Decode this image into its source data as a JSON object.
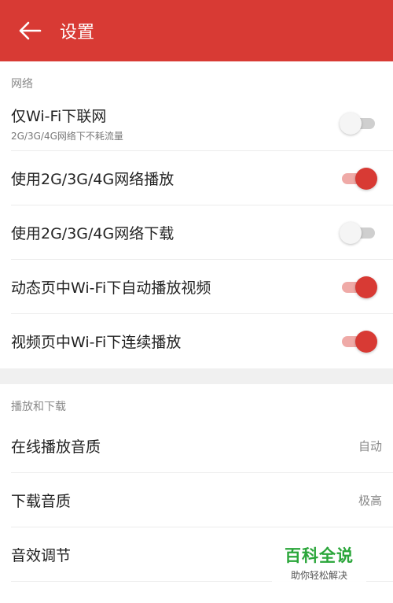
{
  "appbar": {
    "title": "设置",
    "color": "#d83a34"
  },
  "network": {
    "header": "网络",
    "items": [
      {
        "label": "仅Wi-Fi下联网",
        "sub": "2G/3G/4G网络下不耗流量",
        "on": false
      },
      {
        "label": "使用2G/3G/4G网络播放",
        "on": true
      },
      {
        "label": "使用2G/3G/4G网络下载",
        "on": false
      },
      {
        "label": "动态页中Wi-Fi下自动播放视频",
        "on": true
      },
      {
        "label": "视频页中Wi-Fi下连续播放",
        "on": true
      }
    ]
  },
  "playback": {
    "header": "播放和下载",
    "items": [
      {
        "label": "在线播放音质",
        "value": "自动"
      },
      {
        "label": "下载音质",
        "value": "极高"
      },
      {
        "label": "音效调节",
        "value": ""
      }
    ]
  },
  "watermark": {
    "title": "百科全说",
    "sub": "助你轻松解决"
  }
}
